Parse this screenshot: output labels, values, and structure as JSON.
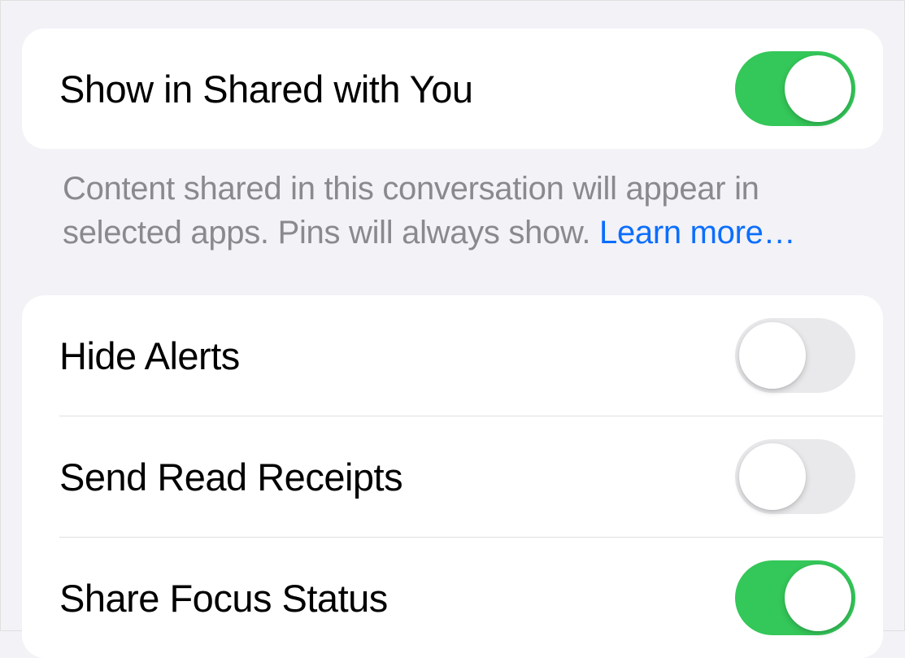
{
  "section1": {
    "items": [
      {
        "label": "Show in Shared with You",
        "on": true
      }
    ],
    "footer_text": "Content shared in this conversation will appear in selected apps. Pins will always show. ",
    "footer_link": "Learn more…"
  },
  "section2": {
    "items": [
      {
        "label": "Hide Alerts",
        "on": false
      },
      {
        "label": "Send Read Receipts",
        "on": false
      },
      {
        "label": "Share Focus Status",
        "on": true
      }
    ]
  },
  "colors": {
    "toggle_on": "#34c759",
    "toggle_off": "#e9e9eb",
    "link": "#0b6efd",
    "background": "#f2f2f7",
    "section_bg": "#ffffff",
    "footer_text": "#8a8a8e"
  }
}
